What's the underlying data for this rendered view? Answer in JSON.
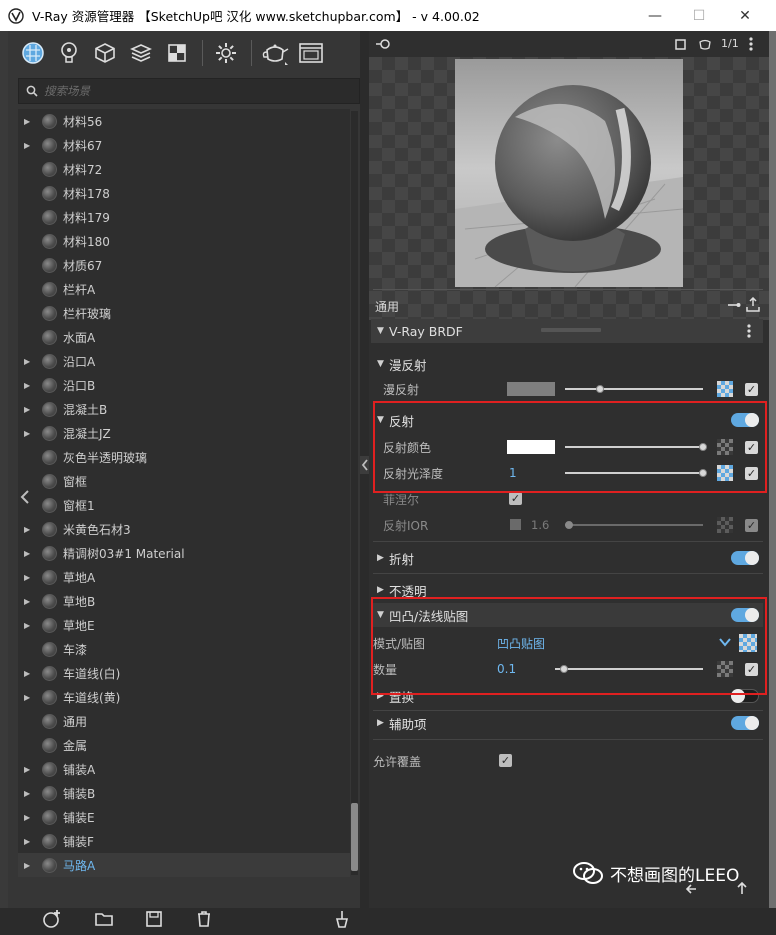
{
  "window": {
    "title": "V-Ray 资源管理器 【SketchUp吧 汉化 www.sketchupbar.com】 - v 4.00.02",
    "minimize": "—",
    "maximize": "☐",
    "close": "✕"
  },
  "toolbar": {
    "icons": [
      "materials-icon",
      "lights-icon",
      "geometry-icon",
      "layers-icon",
      "render-elements-icon",
      "settings-icon",
      "teapot-render-icon",
      "frame-buffer-icon"
    ]
  },
  "search": {
    "placeholder": "搜索场景"
  },
  "materials": [
    {
      "label": "材料56",
      "expand": true
    },
    {
      "label": "材料67",
      "expand": true
    },
    {
      "label": "材料72",
      "expand": false
    },
    {
      "label": "材料178",
      "expand": false
    },
    {
      "label": "材料179",
      "expand": false
    },
    {
      "label": "材料180",
      "expand": false
    },
    {
      "label": "材质67",
      "expand": false
    },
    {
      "label": "栏杆A",
      "expand": false
    },
    {
      "label": "栏杆玻璃",
      "expand": false
    },
    {
      "label": "水面A",
      "expand": false
    },
    {
      "label": "沿口A",
      "expand": true
    },
    {
      "label": "沿口B",
      "expand": true
    },
    {
      "label": "混凝土B",
      "expand": true
    },
    {
      "label": "混凝土JZ",
      "expand": true
    },
    {
      "label": "灰色半透明玻璃",
      "expand": false
    },
    {
      "label": "窗框",
      "expand": false
    },
    {
      "label": "窗框1",
      "expand": false
    },
    {
      "label": "米黄色石材3",
      "expand": true
    },
    {
      "label": "精调树03#1 Material",
      "expand": true
    },
    {
      "label": "草地A",
      "expand": true
    },
    {
      "label": "草地B",
      "expand": true
    },
    {
      "label": "草地E",
      "expand": true
    },
    {
      "label": "车漆",
      "expand": false
    },
    {
      "label": "车道线(白)",
      "expand": true
    },
    {
      "label": "车道线(黄)",
      "expand": true
    },
    {
      "label": "通用",
      "expand": false
    },
    {
      "label": "金属",
      "expand": false
    },
    {
      "label": "铺装A",
      "expand": true
    },
    {
      "label": "铺装B",
      "expand": true
    },
    {
      "label": "铺装E",
      "expand": true
    },
    {
      "label": "铺装F",
      "expand": true
    },
    {
      "label": "马路A",
      "expand": true
    }
  ],
  "selected_material": "马路A",
  "right_top": {
    "page_counter": "1/1"
  },
  "general_label": "通用",
  "brdf": {
    "label": "V-Ray BRDF"
  },
  "diffuse": {
    "section": "漫反射",
    "label": "漫反射",
    "color": "#7f7f7f",
    "slider": 0.25,
    "checked": true
  },
  "reflection": {
    "section": "反射",
    "enabled": true,
    "color_label": "反射颜色",
    "color": "#ffffff",
    "color_slider": 1.0,
    "gloss_label": "反射光泽度",
    "gloss_value": "1",
    "gloss_slider": 1.0,
    "fresnel_label": "菲涅尔",
    "fresnel_checked": true,
    "ior_label": "反射IOR",
    "ior_value": "1.6",
    "ior_slider": 0.03
  },
  "refraction": {
    "section": "折射",
    "enabled": true
  },
  "opacity": {
    "section": "不透明"
  },
  "bump": {
    "section": "凹凸/法线贴图",
    "enabled": true,
    "mode_label": "模式/贴图",
    "mode_value": "凹凸贴图",
    "amount_label": "数量",
    "amount_value": "0.1",
    "amount_slider": 0.06
  },
  "displacement": {
    "section": "置换",
    "enabled": false
  },
  "auxiliary": {
    "section": "辅助项",
    "enabled": true
  },
  "allow_override": {
    "label": "允许覆盖",
    "checked": true
  },
  "watermark": {
    "text": "不想画图的LEEO"
  },
  "colors": {
    "accent": "#5fa8e0",
    "highlight_box": "#e02020"
  }
}
